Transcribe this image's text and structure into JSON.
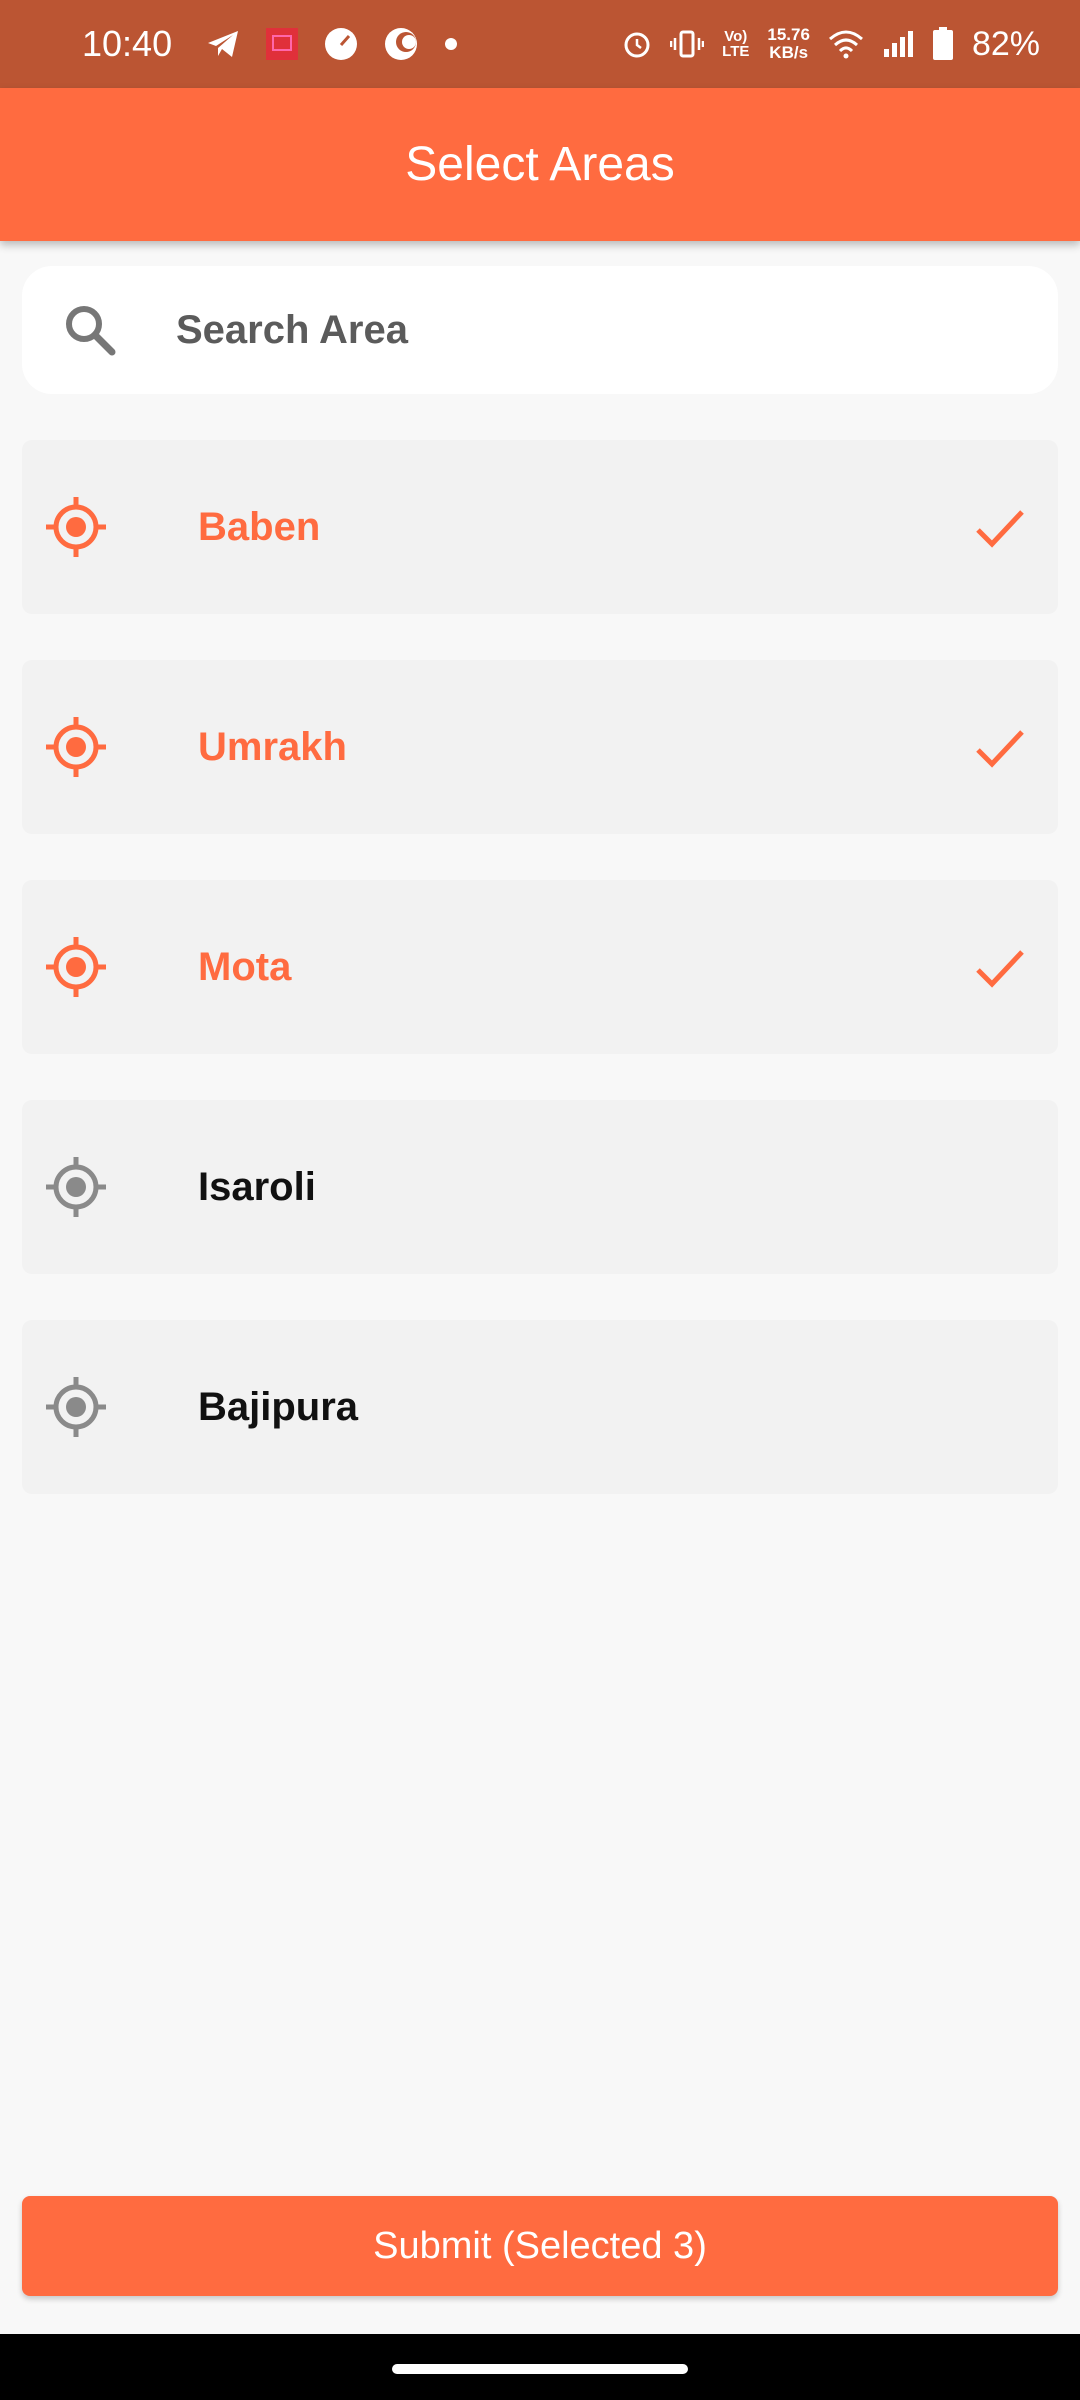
{
  "status_bar": {
    "time": "10:40",
    "left_icons": [
      "telegram-icon",
      "app-notification-icon",
      "speedometer-icon",
      "moon-icon",
      "dot-icon"
    ],
    "speed_value": "15.76",
    "speed_unit": "KB/s",
    "volte_top": "Vo)",
    "volte_bottom": "LTE",
    "battery_percent": "82%"
  },
  "app_bar": {
    "title": "Select Areas"
  },
  "search": {
    "placeholder": "Search Area",
    "value": ""
  },
  "areas": [
    {
      "name": "Baben",
      "selected": true
    },
    {
      "name": "Umrakh",
      "selected": true
    },
    {
      "name": "Mota",
      "selected": true
    },
    {
      "name": "Isaroli",
      "selected": false
    },
    {
      "name": "Bajipura",
      "selected": false
    }
  ],
  "submit_button": {
    "label": "Submit (Selected 3)"
  },
  "colors": {
    "accent": "#ff6b40",
    "status_bar": "#bb5533",
    "unselected_icon": "#8a8a8a",
    "item_background": "#f2f2f2"
  }
}
